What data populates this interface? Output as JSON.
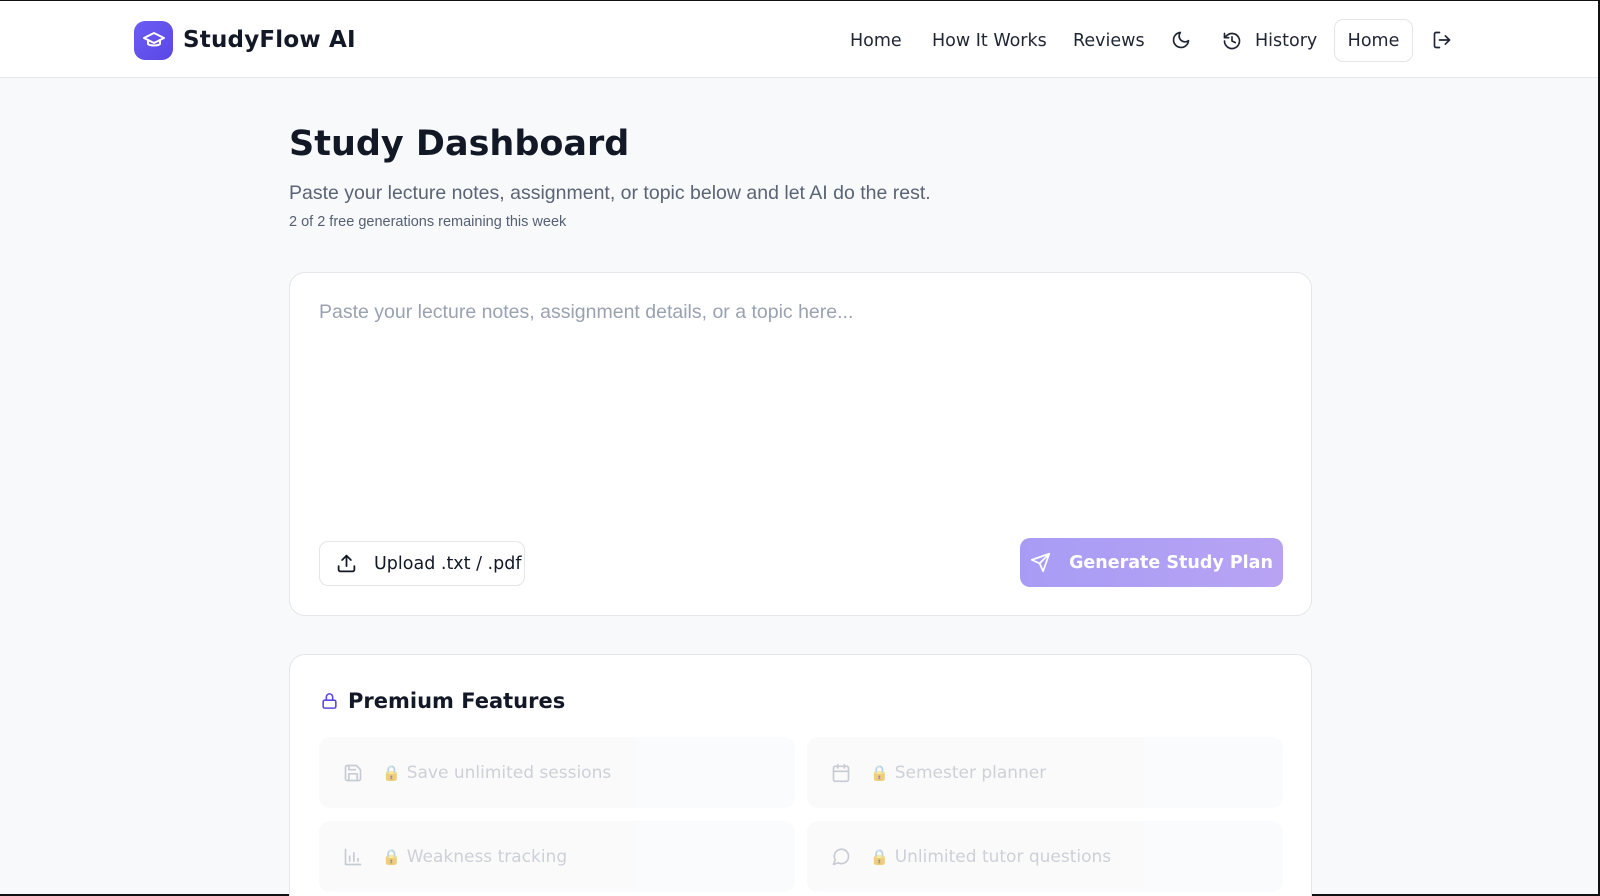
{
  "brand": {
    "name": "StudyFlow AI",
    "logo_icon": "graduation-cap-icon",
    "accent": "#5a47e6"
  },
  "nav": {
    "links": [
      "Home",
      "How It Works",
      "Reviews"
    ],
    "theme_toggle_icon": "moon-icon",
    "history_label": "History",
    "history_icon": "history-icon",
    "home_button": "Home",
    "logout_icon": "logout-icon"
  },
  "dashboard": {
    "title": "Study Dashboard",
    "subtitle": "Paste your lecture notes, assignment, or topic below and let AI do the rest.",
    "quota": "2 of 2 free generations remaining this week"
  },
  "input": {
    "value": "",
    "placeholder": "Paste your lecture notes, assignment details, or a topic here...",
    "upload_label": "Upload .txt / .pdf",
    "upload_icon": "upload-icon",
    "generate_label": "Generate Study Plan",
    "generate_icon": "send-icon"
  },
  "premium": {
    "title": "Premium Features",
    "title_icon": "lock-icon",
    "features": [
      {
        "label": "Save unlimited sessions",
        "icon": "save-icon"
      },
      {
        "label": "Semester planner",
        "icon": "calendar-icon"
      },
      {
        "label": "Weakness tracking",
        "icon": "bar-chart-icon"
      },
      {
        "label": "Unlimited tutor questions",
        "icon": "message-icon"
      }
    ]
  }
}
